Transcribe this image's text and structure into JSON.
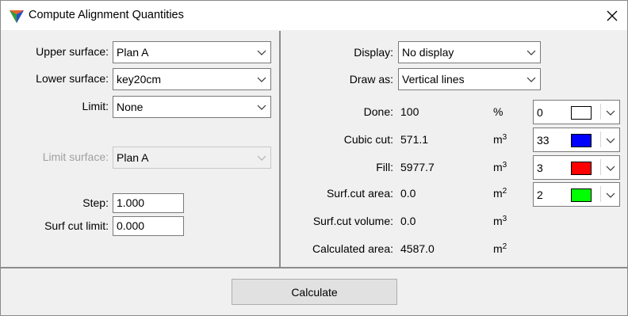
{
  "window": {
    "title": "Compute Alignment Quantities"
  },
  "left": {
    "upper_surface": {
      "label": "Upper surface:",
      "value": "Plan A"
    },
    "lower_surface": {
      "label": "Lower surface:",
      "value": "key20cm"
    },
    "limit": {
      "label": "Limit:",
      "value": "None"
    },
    "limit_surface": {
      "label": "Limit surface:",
      "value": "Plan A"
    },
    "step": {
      "label": "Step:",
      "value": "1.000"
    },
    "surf_cut_limit": {
      "label": "Surf cut limit:",
      "value": "0.000"
    }
  },
  "right": {
    "display": {
      "label": "Display:",
      "value": "No display"
    },
    "draw_as": {
      "label": "Draw as:",
      "value": "Vertical lines"
    },
    "rows": [
      {
        "label": "Done:",
        "value": "100",
        "unit": "%",
        "unit_exp": "",
        "level": "0",
        "color": "#ffffff"
      },
      {
        "label": "Cubic cut:",
        "value": "571.1",
        "unit": "m",
        "unit_exp": "3",
        "level": "33",
        "color": "#0000ff"
      },
      {
        "label": "Fill:",
        "value": "5977.7",
        "unit": "m",
        "unit_exp": "3",
        "level": "3",
        "color": "#ff0000"
      },
      {
        "label": "Surf.cut area:",
        "value": "0.0",
        "unit": "m",
        "unit_exp": "2",
        "level": "2",
        "color": "#00ff00"
      },
      {
        "label": "Surf.cut volume:",
        "value": "0.0",
        "unit": "m",
        "unit_exp": "3"
      },
      {
        "label": "Calculated area:",
        "value": "4587.0",
        "unit": "m",
        "unit_exp": "2"
      }
    ]
  },
  "footer": {
    "calculate_label": "Calculate"
  }
}
